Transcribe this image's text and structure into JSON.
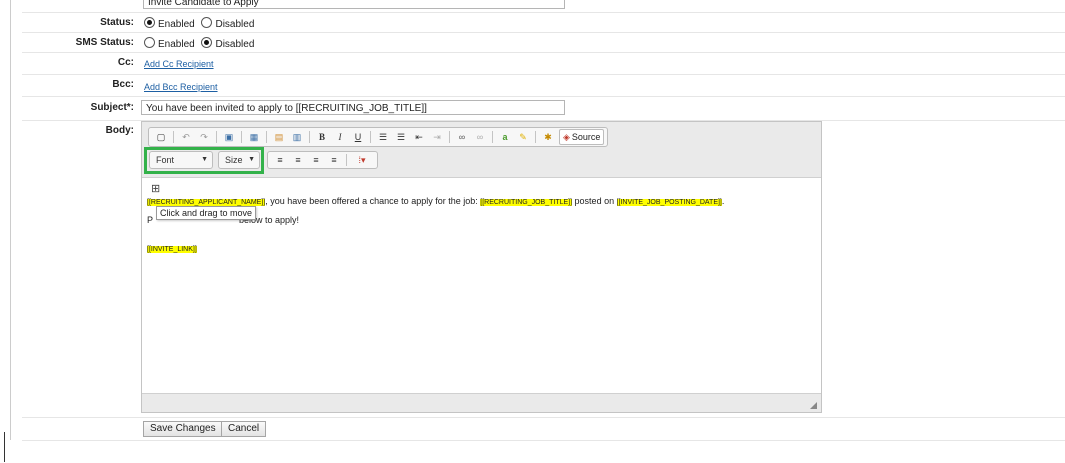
{
  "top_field": {
    "value": "Invite Candidate to Apply"
  },
  "status": {
    "label": "Status:",
    "options": [
      "Enabled",
      "Disabled"
    ],
    "selected": "Enabled"
  },
  "sms_status": {
    "label": "SMS Status:",
    "options": [
      "Enabled",
      "Disabled"
    ],
    "selected": "Disabled"
  },
  "cc": {
    "label": "Cc:",
    "link": "Add Cc Recipient"
  },
  "bcc": {
    "label": "Bcc:",
    "link": "Add Bcc Recipient"
  },
  "subject": {
    "label": "Subject*:",
    "value": "You have been invited to apply to [[RECRUITING_JOB_TITLE]]"
  },
  "body": {
    "label": "Body:",
    "toolbar": {
      "source_label": "Source",
      "font_label": "Font",
      "size_label": "Size"
    },
    "content": {
      "tag_applicant": "[[RECRUITING_APPLICANT_NAME]]",
      "text1": ", you have been offered a chance to apply for the job: ",
      "tag_job_title": "[[RECRUITING_JOB_TITLE]]",
      "text2": " posted on ",
      "tag_posting_date": "[[INVITE_JOB_POSTING_DATE]]",
      "text3": ".",
      "line2_prefix": "P",
      "line2_suffix": "below to apply!",
      "tag_invite_link": "[[INVITE_LINK]]"
    },
    "tooltip": "Click and drag to move"
  },
  "buttons": {
    "save": "Save Changes",
    "cancel": "Cancel"
  },
  "colors": {
    "highlight_box": "#33b24a",
    "tag_bg": "#ffff00",
    "link": "#1d5fa3"
  }
}
